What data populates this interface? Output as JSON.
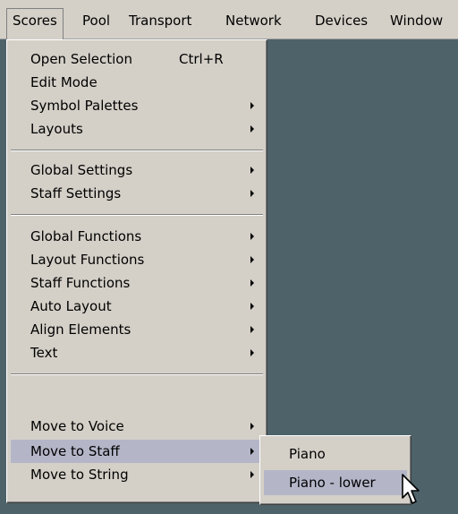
{
  "menubar": {
    "items": [
      "Scores",
      "Pool",
      "Transport",
      "Network",
      "Devices",
      "Window"
    ]
  },
  "scores_menu": {
    "items": [
      {
        "label": "Open Selection",
        "shortcut": "Ctrl+R",
        "submenu": false
      },
      {
        "label": "Edit Mode",
        "submenu": false
      },
      {
        "label": "Symbol Palettes",
        "submenu": true
      },
      {
        "label": "Layouts",
        "submenu": true
      },
      {
        "label": "Global Settings",
        "submenu": true
      },
      {
        "label": "Staff Settings",
        "submenu": true
      },
      {
        "label": "Global Functions",
        "submenu": true
      },
      {
        "label": "Layout Functions",
        "submenu": true
      },
      {
        "label": "Staff Functions",
        "submenu": true
      },
      {
        "label": "Auto Layout",
        "submenu": true
      },
      {
        "label": "Align Elements",
        "submenu": true
      },
      {
        "label": "Text",
        "submenu": true
      },
      {
        "label": "Move to Voice",
        "submenu": true
      },
      {
        "label": "Move to Staff",
        "submenu": true,
        "highlighted": true
      },
      {
        "label": "Move to String",
        "submenu": true
      }
    ]
  },
  "move_to_staff_submenu": {
    "items": [
      {
        "label": "Piano"
      },
      {
        "label": "Piano - lower",
        "highlighted": true
      }
    ]
  },
  "colors": {
    "menu_bg": "#d4d0c8",
    "highlight": "#b4b6c8",
    "workspace": "#4e6269"
  },
  "icons": {
    "cursor": "mouse-pointer-icon",
    "submenu_arrow": "submenu-arrow-icon"
  }
}
